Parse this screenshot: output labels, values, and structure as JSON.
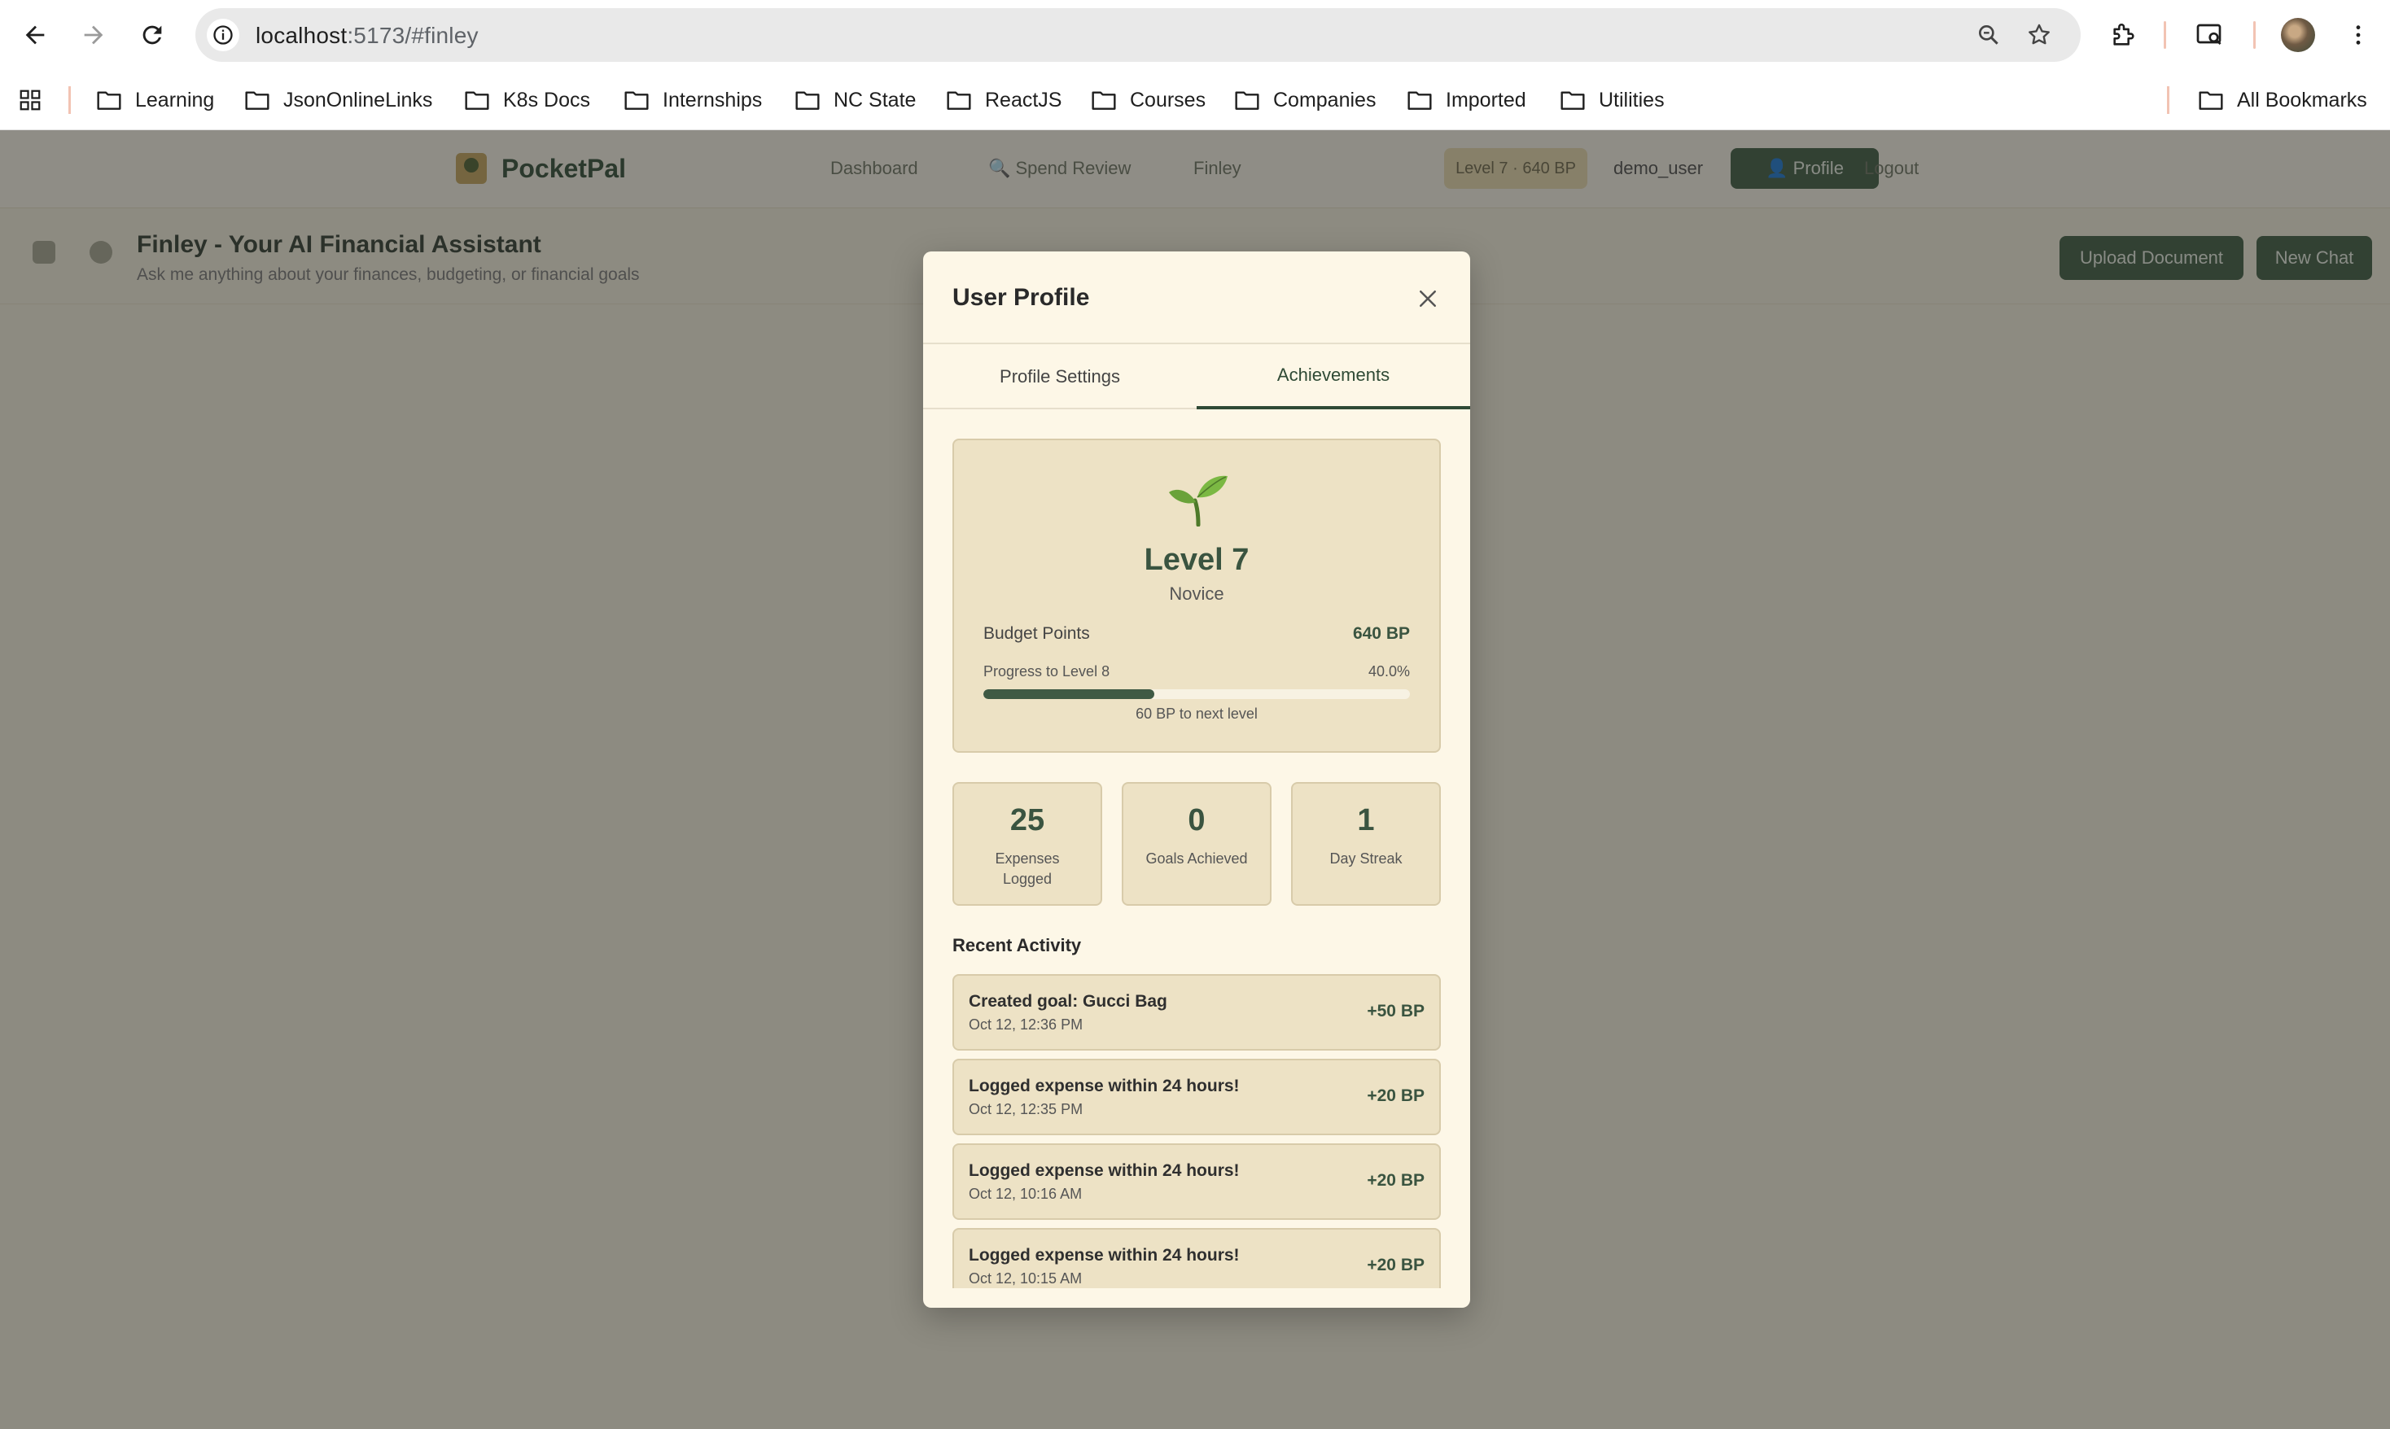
{
  "browser": {
    "url_host": "localhost",
    "url_rest": ":5173/#finley",
    "bookmarks": [
      "Learning",
      "JsonOnlineLinks",
      "K8s Docs",
      "Internships",
      "NC State",
      "ReactJS",
      "Courses",
      "Companies",
      "Imported",
      "Utilities"
    ],
    "all_bookmarks": "All Bookmarks"
  },
  "app": {
    "brand": "PocketPal",
    "nav": [
      "Dashboard",
      "🔍 Spend Review",
      "Finley"
    ],
    "level_pill": "Level 7 · 640 BP",
    "username": "demo_user",
    "profile_button": "👤 Profile",
    "logout": "Logout",
    "chat_title": "Finley - Your AI Financial Assistant",
    "chat_subtitle": "Ask me anything about your finances, budgeting, or financial goals",
    "upload_button": "Upload Document",
    "new_chat_button": "New Chat"
  },
  "modal": {
    "title": "User Profile",
    "tabs": [
      "Profile Settings",
      "Achievements"
    ],
    "active_tab": "Achievements",
    "level": {
      "icon": "sprout-icon",
      "title": "Level 7",
      "rank": "Novice",
      "budget_points_label": "Budget Points",
      "budget_points_value": "640 BP",
      "progress_label": "Progress to Level 8",
      "progress_percent_text": "40.0%",
      "progress_fraction": 0.4,
      "progress_note": "60 BP to next level"
    },
    "stats": [
      {
        "value": "25",
        "label": "Expenses Logged"
      },
      {
        "value": "0",
        "label": "Goals Achieved"
      },
      {
        "value": "1",
        "label": "Day Streak"
      }
    ],
    "recent_heading": "Recent Activity",
    "activities": [
      {
        "title": "Created goal: Gucci Bag",
        "date": "Oct 12, 12:36 PM",
        "points": "+50 BP"
      },
      {
        "title": "Logged expense within 24 hours!",
        "date": "Oct 12, 12:35 PM",
        "points": "+20 BP"
      },
      {
        "title": "Logged expense within 24 hours!",
        "date": "Oct 12, 10:16 AM",
        "points": "+20 BP"
      },
      {
        "title": "Logged expense within 24 hours!",
        "date": "Oct 12, 10:15 AM",
        "points": "+20 BP"
      }
    ]
  },
  "colors": {
    "accent": "#3f5a44",
    "card": "#ede2c5",
    "modal_bg": "#fdf7e7"
  }
}
